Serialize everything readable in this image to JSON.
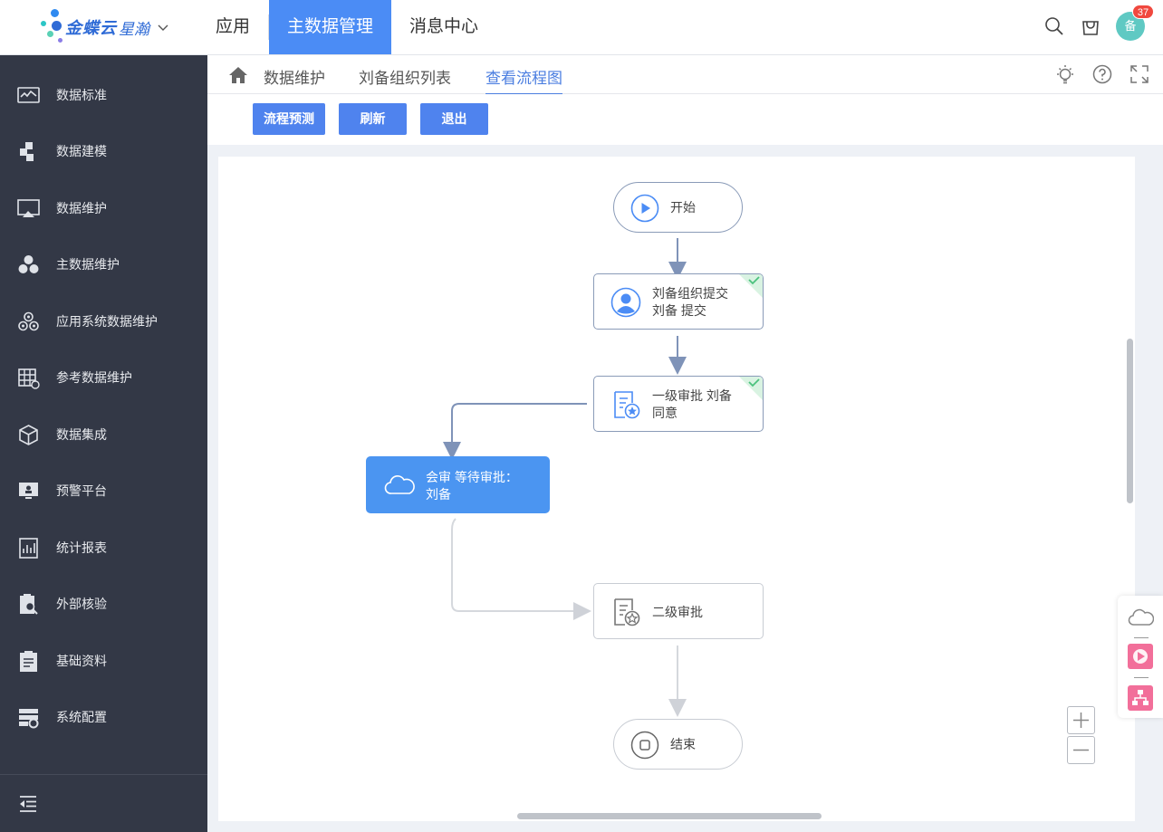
{
  "brand": {
    "name": "金蝶云",
    "product": "星瀚"
  },
  "nav": {
    "items": [
      "应用",
      "主数据管理",
      "消息中心"
    ],
    "active_index": 1
  },
  "header": {
    "notification_count": "37",
    "avatar_text": "备"
  },
  "sidebar": {
    "items": [
      {
        "label": "数据标准",
        "icon": "data-standard-icon"
      },
      {
        "label": "数据建模",
        "icon": "data-modeling-icon"
      },
      {
        "label": "数据维护",
        "icon": "data-maintenance-icon"
      },
      {
        "label": "主数据维护",
        "icon": "master-data-icon"
      },
      {
        "label": "应用系统数据维护",
        "icon": "app-system-data-icon"
      },
      {
        "label": "参考数据维护",
        "icon": "reference-data-icon"
      },
      {
        "label": "数据集成",
        "icon": "data-integration-icon"
      },
      {
        "label": "预警平台",
        "icon": "alert-platform-icon"
      },
      {
        "label": "统计报表",
        "icon": "statistics-report-icon"
      },
      {
        "label": "外部核验",
        "icon": "external-verify-icon"
      },
      {
        "label": "基础资料",
        "icon": "basic-data-icon"
      },
      {
        "label": "系统配置",
        "icon": "system-config-icon"
      }
    ]
  },
  "breadcrumb": {
    "items": [
      "数据维护",
      "刘备组织列表",
      "查看流程图"
    ],
    "active_index": 2
  },
  "toolbar": {
    "predict_label": "流程预测",
    "refresh_label": "刷新",
    "exit_label": "退出"
  },
  "flow": {
    "start_label": "开始",
    "submit": {
      "line1": "刘备组织提交",
      "line2": "刘备 提交",
      "status": "done"
    },
    "first_approval": {
      "line1": "一级审批 刘备",
      "line2": "同意",
      "status": "done"
    },
    "countersign": {
      "line1": "会审 等待审批：",
      "line2": "刘备",
      "status": "active"
    },
    "second_approval": {
      "line1": "二级审批",
      "status": "pending"
    },
    "end_label": "结束"
  },
  "colors": {
    "accent": "#4b8cf5",
    "button": "#4f83ee",
    "sidebar_bg": "#333846",
    "active_node": "#4b95f1",
    "done_check": "#6fd39a",
    "badge": "#f0483e"
  }
}
